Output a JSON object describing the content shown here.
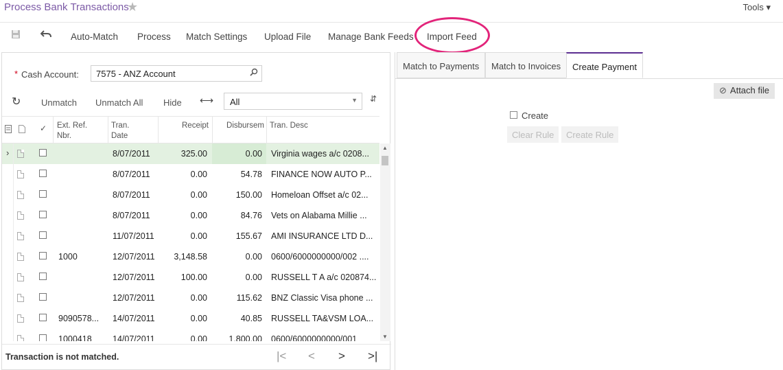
{
  "header": {
    "title": "Process Bank Transactions",
    "tools_label": "Tools ▾"
  },
  "toolbar": {
    "auto_match": "Auto-Match",
    "process": "Process",
    "match_settings": "Match Settings",
    "upload_file": "Upload File",
    "manage_bank_feeds": "Manage Bank Feeds",
    "import_feed": "Import Feed",
    "highlight_color": "#e2247a"
  },
  "form": {
    "cash_account_label": "Cash Account:",
    "cash_account_value": "7575 - ANZ Account"
  },
  "grid_toolbar": {
    "unmatch": "Unmatch",
    "unmatch_all": "Unmatch All",
    "hide": "Hide",
    "filter_value": "All"
  },
  "grid": {
    "columns": {
      "ext_ref": "Ext. Ref.",
      "ext_ref_2": "Nbr.",
      "tran_date": "Tran.",
      "tran_date_2": "Date",
      "receipt": "Receipt",
      "disbursement": "Disbursem",
      "tran_desc": "Tran. Desc"
    },
    "rows": [
      {
        "ext_ref": "",
        "date": "8/07/2011",
        "receipt": "325.00",
        "disb": "0.00",
        "desc": "Virginia wages a/c 0208...",
        "selected": true
      },
      {
        "ext_ref": "",
        "date": "8/07/2011",
        "receipt": "0.00",
        "disb": "54.78",
        "desc": "FINANCE NOW AUTO P..."
      },
      {
        "ext_ref": "",
        "date": "8/07/2011",
        "receipt": "0.00",
        "disb": "150.00",
        "desc": "Homeloan Offset a/c 02..."
      },
      {
        "ext_ref": "",
        "date": "8/07/2011",
        "receipt": "0.00",
        "disb": "84.76",
        "desc": "Vets on Alabama Millie ..."
      },
      {
        "ext_ref": "",
        "date": "11/07/2011",
        "receipt": "0.00",
        "disb": "155.67",
        "desc": "AMI INSURANCE LTD D..."
      },
      {
        "ext_ref": "1000",
        "date": "12/07/2011",
        "receipt": "3,148.58",
        "disb": "0.00",
        "desc": "0600/6000000000/002 ...."
      },
      {
        "ext_ref": "",
        "date": "12/07/2011",
        "receipt": "100.00",
        "disb": "0.00",
        "desc": "RUSSELL T A a/c 020874..."
      },
      {
        "ext_ref": "",
        "date": "12/07/2011",
        "receipt": "0.00",
        "disb": "115.62",
        "desc": "BNZ Classic Visa phone ..."
      },
      {
        "ext_ref": "9090578...",
        "date": "14/07/2011",
        "receipt": "0.00",
        "disb": "40.85",
        "desc": "RUSSELL TA&VSM LOA..."
      },
      {
        "ext_ref": "1000418",
        "date": "14/07/2011",
        "receipt": "0.00",
        "disb": "1,800.00",
        "desc": "0600/6000000000/001"
      }
    ]
  },
  "footer": {
    "status": "Transaction is not matched."
  },
  "right": {
    "tabs": [
      "Match to Payments",
      "Match to Invoices",
      "Create Payment"
    ],
    "active_tab": "Create Payment",
    "attach_file": "Attach file",
    "create_label": "Create",
    "clear_rule": "Clear Rule",
    "create_rule": "Create Rule"
  }
}
